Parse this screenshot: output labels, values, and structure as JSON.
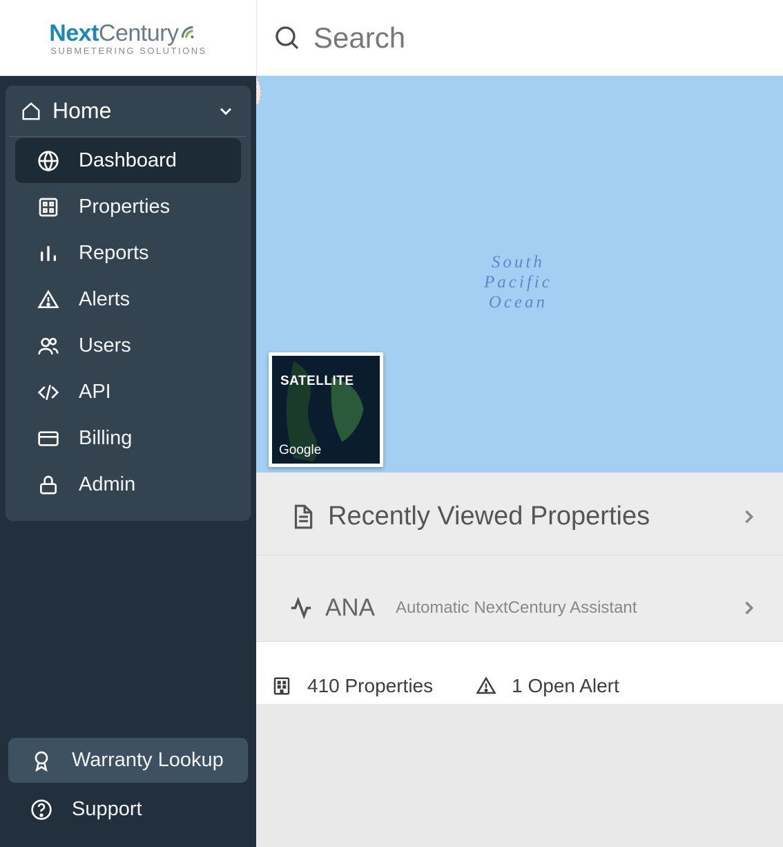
{
  "brand": {
    "name1": "Next",
    "name2": "Century",
    "tagline": "SUBMETERING SOLUTIONS"
  },
  "search": {
    "placeholder": "Search"
  },
  "sidebar": {
    "header": "Home",
    "items": [
      {
        "label": "Dashboard",
        "icon": "globe-icon",
        "active": true
      },
      {
        "label": "Properties",
        "icon": "building-icon",
        "active": false
      },
      {
        "label": "Reports",
        "icon": "bar-chart-icon",
        "active": false
      },
      {
        "label": "Alerts",
        "icon": "alert-triangle-icon",
        "active": false
      },
      {
        "label": "Users",
        "icon": "users-icon",
        "active": false
      },
      {
        "label": "API",
        "icon": "code-icon",
        "active": false
      },
      {
        "label": "Billing",
        "icon": "credit-card-icon",
        "active": false
      },
      {
        "label": "Admin",
        "icon": "lock-icon",
        "active": false
      }
    ],
    "bottom": [
      {
        "label": "Warranty Lookup",
        "icon": "award-icon",
        "style": "pill"
      },
      {
        "label": "Support",
        "icon": "help-circle-icon",
        "style": "plain"
      }
    ]
  },
  "map": {
    "ocean_label_line1": "South",
    "ocean_label_line2": "Pacific",
    "ocean_label_line3": "Ocean",
    "satellite_label": "SATELLITE",
    "satellite_brand": "Google"
  },
  "sections": {
    "recent": {
      "title": "Recently Viewed Properties"
    },
    "ana": {
      "title": "ANA",
      "subtitle": "Automatic NextCentury Assistant"
    }
  },
  "footer": {
    "properties_count": "410 Properties",
    "alerts_count": "1 Open Alert"
  }
}
